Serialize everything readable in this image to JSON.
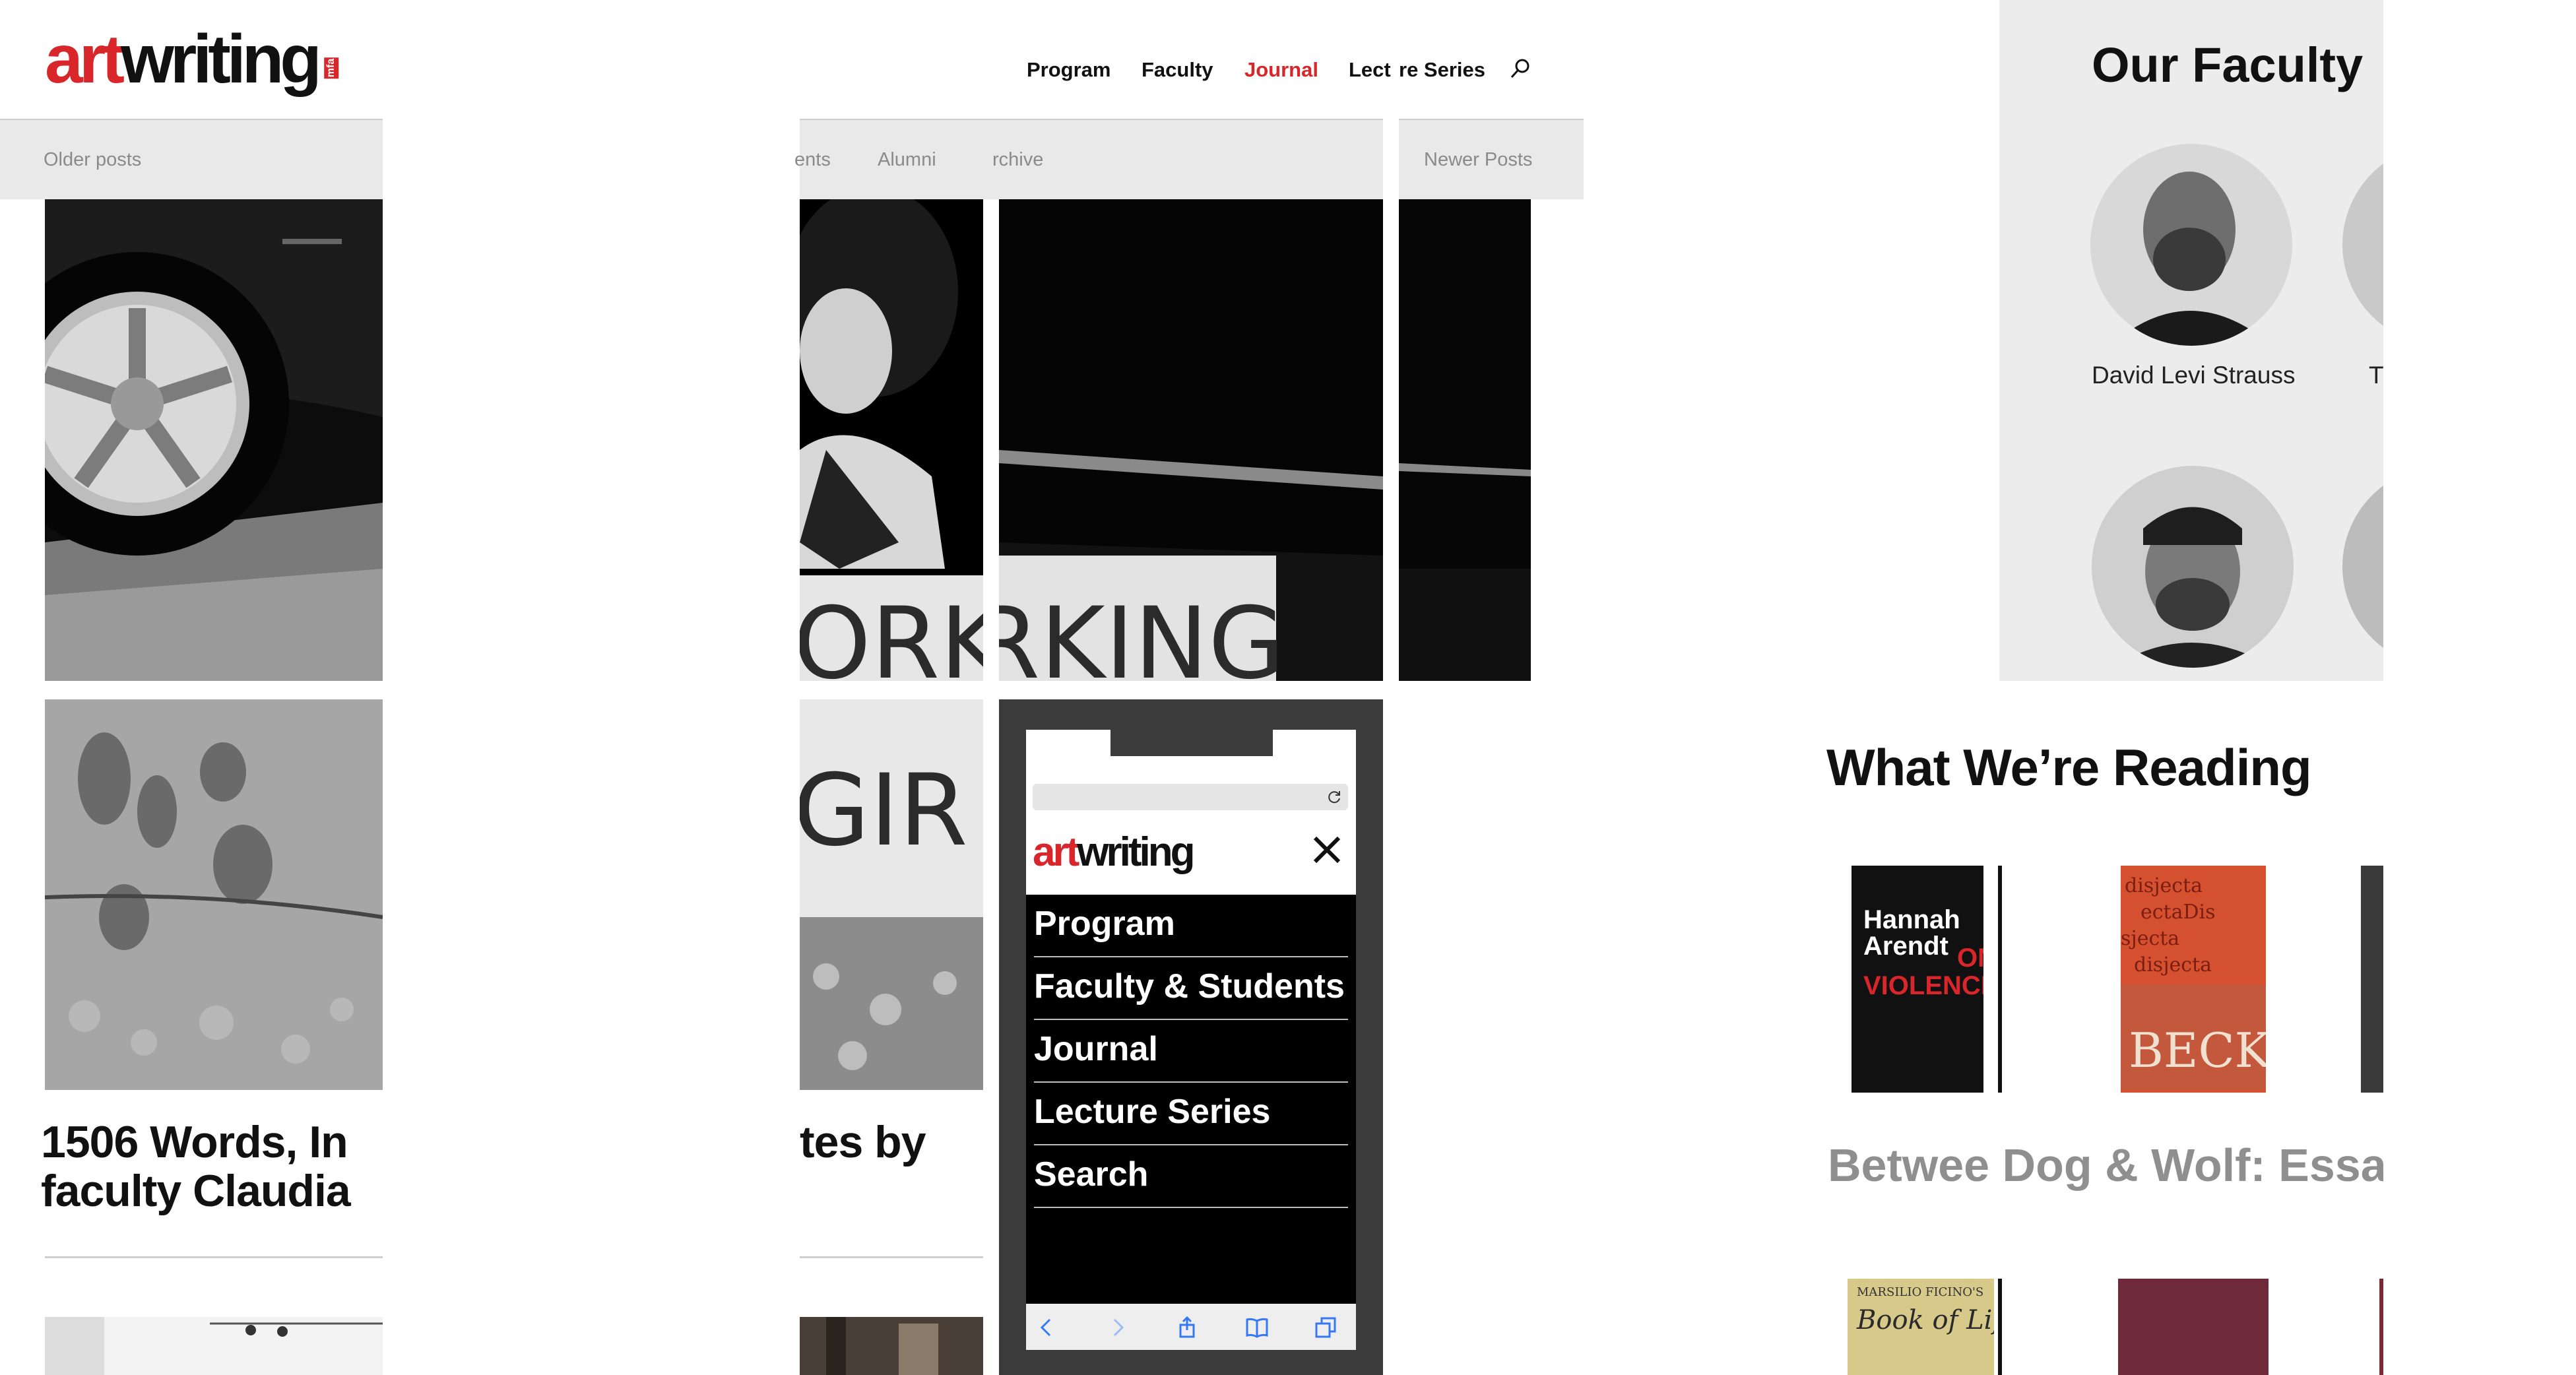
{
  "header": {
    "logo": {
      "art": "art",
      "writing": "writing",
      "mfa": "mfa"
    },
    "nav": [
      {
        "label": "Program",
        "active": false
      },
      {
        "label": "Faculty",
        "active": false
      },
      {
        "label": "Journal",
        "active": true
      },
      {
        "label": "Lect",
        "active": false
      },
      {
        "label": "re Series",
        "active": false
      }
    ]
  },
  "subnav": {
    "older_posts": "Older posts",
    "items": [
      "ents",
      "Alumni",
      "rchive"
    ],
    "newer_posts": "Newer Posts"
  },
  "posts": {
    "headline_left_line1": "1506 Words, In",
    "headline_left_line2": "faculty Claudia",
    "headline_right": "tes by",
    "sign_text_top": "ORKING",
    "sign_text_bottom": "GIR"
  },
  "phone": {
    "logo": {
      "art": "art",
      "writing": "writing"
    },
    "menu": [
      "Program",
      "Faculty & Students",
      "Journal",
      "Lecture Series",
      "Search"
    ]
  },
  "faculty": {
    "title": "Our Faculty",
    "people": [
      {
        "name": "David Levi Strauss"
      },
      {
        "name": "T"
      }
    ]
  },
  "reading": {
    "title": "What We’re Reading",
    "book_title": "Betwee Dog & Wolf: Essa",
    "books": [
      {
        "line1": "Hannah",
        "line2": "Arendt",
        "line3": "ON",
        "line4": "VIOLENCE"
      },
      {
        "line1": "BECKETT"
      },
      {
        "line1": "MARSILIO FICINO'S",
        "line2": "Book of Life"
      }
    ]
  },
  "colors": {
    "accent": "#d8262a",
    "strip": "#e9e9e9",
    "panel": "#ececec",
    "phone_frame": "#3b3b3b"
  }
}
